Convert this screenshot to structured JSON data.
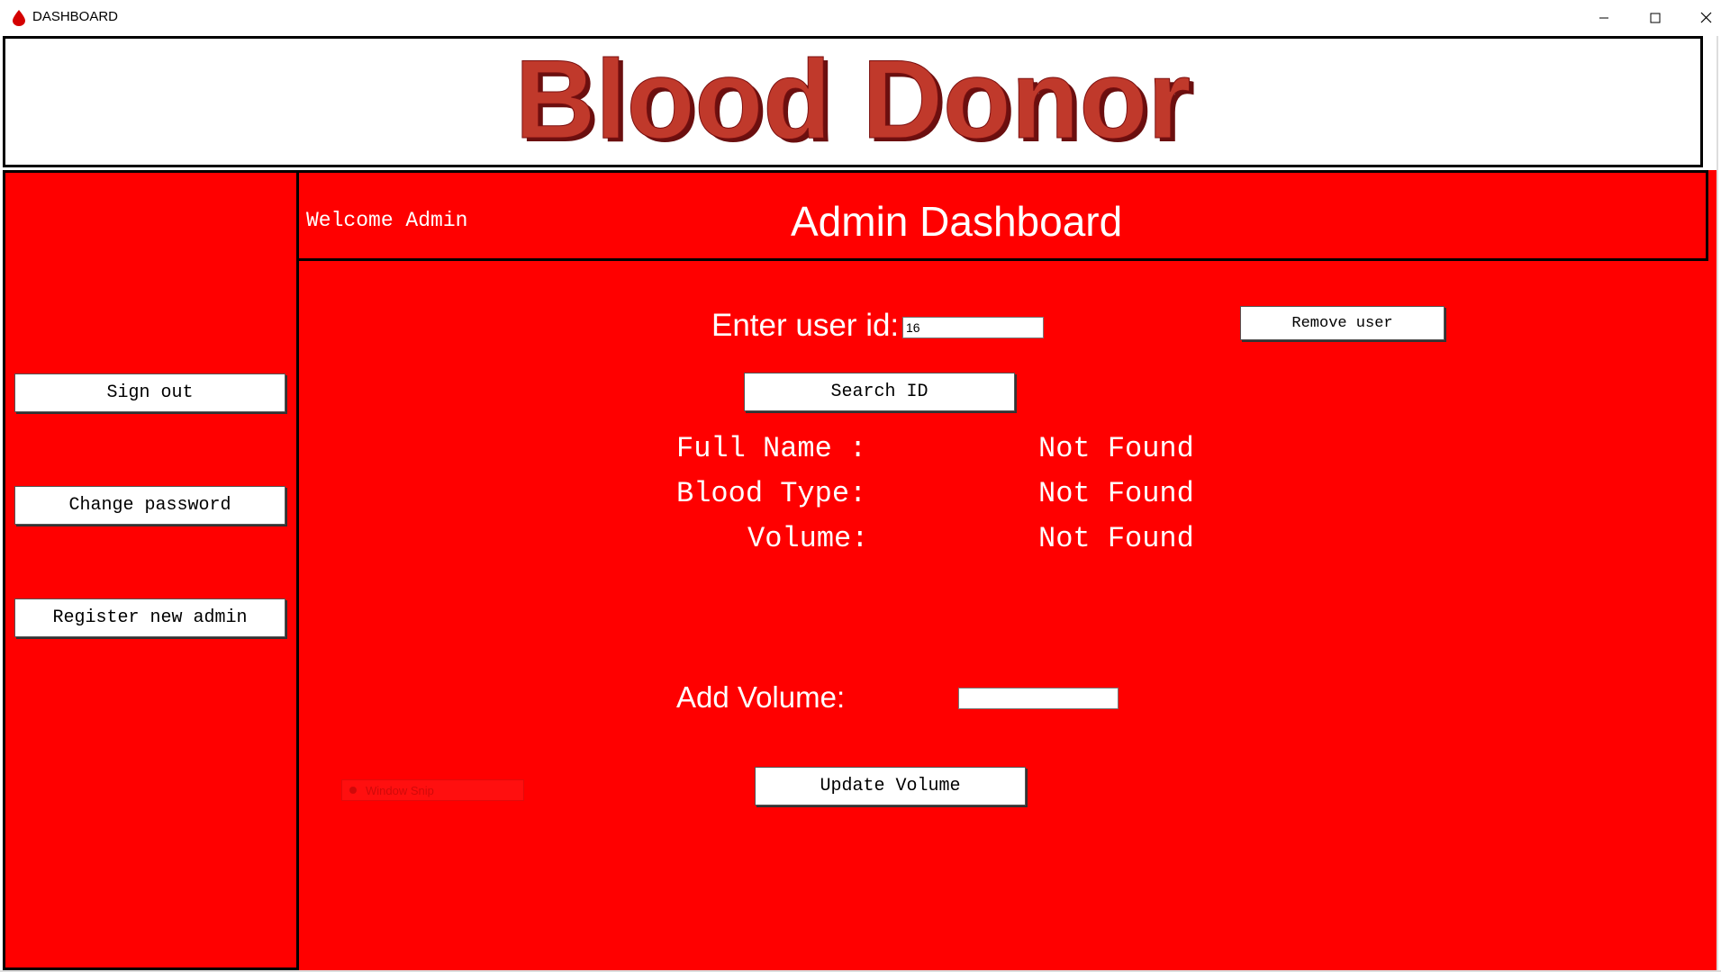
{
  "window": {
    "title": "DASHBOARD",
    "icon": "blood-drop-icon",
    "controls": [
      "minimize-icon",
      "maximize-icon",
      "close-icon"
    ]
  },
  "header": {
    "logo_text": "Blood Donor",
    "logo_color": "#b22222"
  },
  "sidebar": {
    "buttons": {
      "sign_out": "Sign out",
      "change_password": "Change password",
      "register_admin": "Register new admin"
    }
  },
  "main": {
    "welcome": "Welcome Admin",
    "title": "Admin Dashboard",
    "user_id_label": "Enter user id:",
    "user_id_value": "16",
    "remove_user": "Remove user",
    "search_id": "Search ID",
    "fields": {
      "full_name_label": "Full Name :",
      "blood_type_label": "Blood Type:",
      "volume_label": "Volume:",
      "full_name_value": "Not Found",
      "blood_type_value": "Not Found",
      "volume_value": "Not Found"
    },
    "add_volume_label": "Add Volume:",
    "add_volume_value": "",
    "update_volume": "Update Volume",
    "ghost_overlay": "Window Snip"
  },
  "colors": {
    "background": "#ff0000",
    "text": "#ffffff",
    "border": "#000000"
  }
}
